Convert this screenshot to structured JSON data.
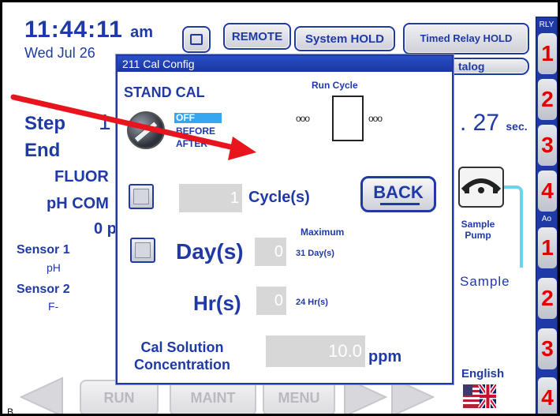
{
  "header": {
    "time": "11:44:11",
    "ampm": "am",
    "date": "Wed  Jul 26",
    "buttons": {
      "remote": "REMOTE",
      "system_hold": "System HOLD",
      "timed_relay": "Timed Relay HOLD",
      "catalog": "talog"
    }
  },
  "relay_strip": {
    "rly_label": "RLY",
    "ao_label": "Ao",
    "relays": [
      "1",
      "2",
      "3",
      "4"
    ],
    "ao": [
      "1",
      "2",
      "3",
      "4"
    ]
  },
  "background": {
    "step_label": "Step",
    "step_value": "1",
    "end_label": "End",
    "fluor_label": "FLUOR",
    "ph_label": "pH COM",
    "zero_label": "0 p",
    "sensor1_label": "Sensor 1",
    "sensor1_type": "pH",
    "sensor2_label": "Sensor 2",
    "sensor2_type": "F-",
    "seconds_value": ". 27",
    "seconds_unit": "sec.",
    "pump_label": "Sample Pump",
    "sample_label": "Sample",
    "language": "English",
    "corner_label": "B"
  },
  "nav": {
    "run": "RUN",
    "maint": "MAINT",
    "menu": "MENU"
  },
  "dialog": {
    "title": "211  Cal Config",
    "stand_cal": "STAND CAL",
    "run_cycle": "Run Cycle",
    "options": [
      "OFF",
      "BEFORE",
      "AFTER"
    ],
    "selected_option": "OFF",
    "cycles_value": "1",
    "cycles_label": "Cycle(s)",
    "back_label": "BACK",
    "maximum_label": "Maximum",
    "days_label": "Day(s)",
    "days_value": "0",
    "days_max": "31 Day(s)",
    "hours_label": "Hr(s)",
    "hours_value": "0",
    "hours_max": "24 Hr(s)",
    "cal_solution_label": "Cal Solution Concentration",
    "concentration_value": "10.0",
    "concentration_unit": "ppm",
    "run_cycle_dots": "ooo"
  },
  "colors": {
    "accent": "#1f3aa6",
    "relay_text": "#e00000",
    "arrow": "#e8141e",
    "selected_option_bg": "#35a6f0"
  }
}
